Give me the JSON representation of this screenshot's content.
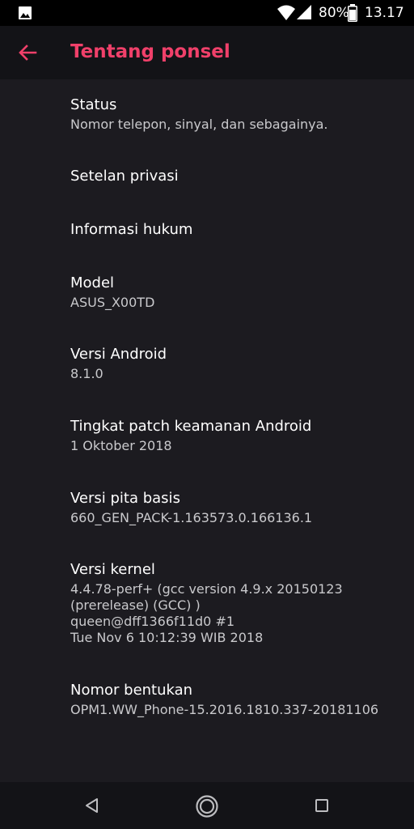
{
  "status_bar": {
    "battery_percent": "80%",
    "time": "13.17"
  },
  "app_bar": {
    "title": "Tentang ponsel"
  },
  "items": [
    {
      "label": "Status",
      "value": "Nomor telepon, sinyal, dan sebagainya."
    },
    {
      "label": "Setelan privasi",
      "value": ""
    },
    {
      "label": "Informasi hukum",
      "value": ""
    },
    {
      "label": "Model",
      "value": "ASUS_X00TD"
    },
    {
      "label": "Versi Android",
      "value": "8.1.0"
    },
    {
      "label": "Tingkat patch keamanan Android",
      "value": "1 Oktober 2018"
    },
    {
      "label": "Versi pita basis",
      "value": "660_GEN_PACK-1.163573.0.166136.1"
    },
    {
      "label": "Versi kernel",
      "value": "4.4.78-perf+ (gcc version 4.9.x 20150123\n(prerelease) (GCC) )\nqueen@dff1366f11d0 #1\nTue Nov 6 10:12:39 WIB 2018"
    },
    {
      "label": "Nomor bentukan",
      "value": "OPM1.WW_Phone-15.2016.1810.337-20181106"
    }
  ],
  "colors": {
    "accent": "#f0406a",
    "background": "#1c1b20",
    "app_bar": "#131317",
    "status_bar": "#000000"
  },
  "icons": {
    "status_left": "image-gallery-icon",
    "wifi": "wifi-icon",
    "signal": "cellular-signal-icon",
    "battery": "battery-icon",
    "back": "arrow-back-icon",
    "nav_back": "nav-back-triangle-icon",
    "nav_home": "nav-home-circle-icon",
    "nav_recent": "nav-recents-square-icon"
  }
}
